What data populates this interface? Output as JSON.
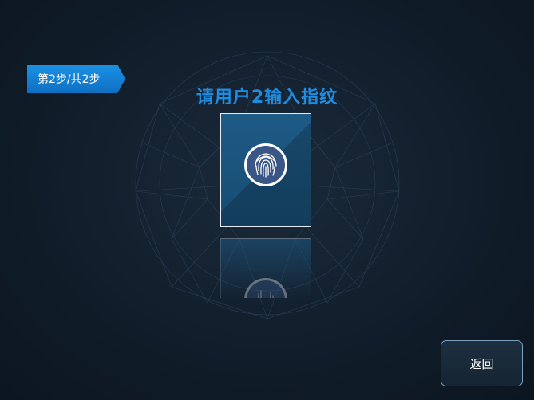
{
  "step_badge": {
    "label": "第2步/共2步"
  },
  "prompt": {
    "title": "请用户2输入指纹"
  },
  "fingerprint": {
    "icon": "fingerprint-icon"
  },
  "footer": {
    "back_label": "返回"
  },
  "colors": {
    "accent": "#1b91e6",
    "title": "#1f8cdf",
    "background": "#142231",
    "card": "#1e5b86"
  }
}
